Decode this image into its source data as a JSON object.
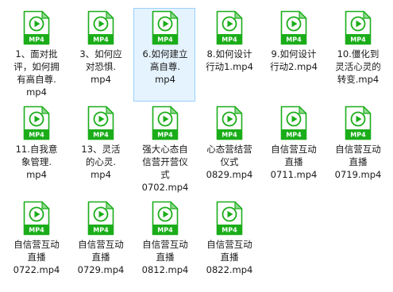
{
  "icon": {
    "name": "mp4-video-file-icon",
    "badge_text": "MP4",
    "accent": "#1aad19",
    "fold": "#8fd88e"
  },
  "selected_index": 2,
  "files": [
    {
      "name": "1、面对批\n评，如何拥\n有高自尊.\nmp4"
    },
    {
      "name": "3、如何应\n对恐惧.\nmp4"
    },
    {
      "name": "6.如何建立\n高自尊.\nmp4"
    },
    {
      "name": "8.如何设计\n行动1.mp4"
    },
    {
      "name": "9.如何设计\n行动2.mp4"
    },
    {
      "name": "10.僵化到\n灵活心灵的\n转变.mp4"
    },
    {
      "name": "11.自我意\n象管理.\nmp4"
    },
    {
      "name": "13、灵活\n的心灵.\nmp4"
    },
    {
      "name": "强大心态自\n信营开营仪\n式\n0702.mp4"
    },
    {
      "name": "心态营结营\n仪式\n0829.mp4"
    },
    {
      "name": "自信营互动\n直播\n0711.mp4"
    },
    {
      "name": "自信营互动\n直播\n0719.mp4"
    },
    {
      "name": "自信营互动\n直播\n0722.mp4"
    },
    {
      "name": "自信营互动\n直播\n0729.mp4"
    },
    {
      "name": "自信营互动\n直播\n0812.mp4"
    },
    {
      "name": "自信营互动\n直播\n0822.mp4"
    }
  ]
}
